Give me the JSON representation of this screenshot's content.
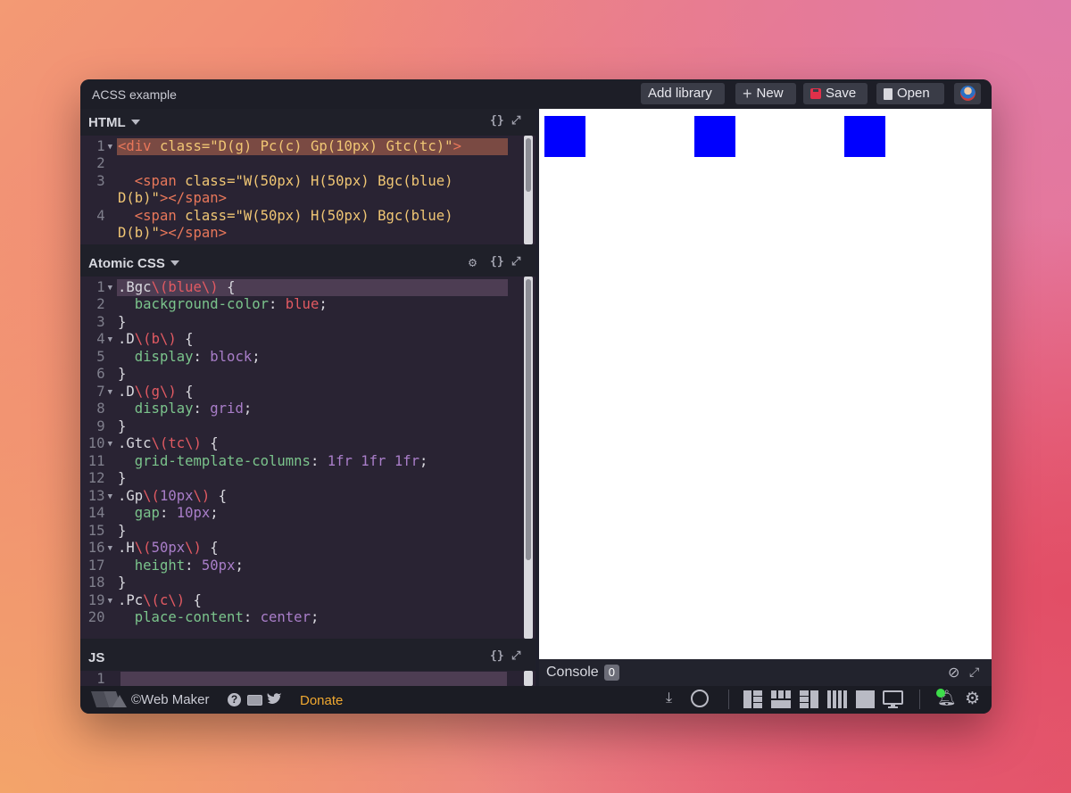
{
  "app": {
    "title": "ACSS example",
    "buttons": {
      "add_library": "Add library",
      "new": "New",
      "save": "Save",
      "open": "Open"
    }
  },
  "html_pane": {
    "label": "HTML",
    "lines": [
      {
        "n": "1",
        "t": "<div class=\"D(g) Pc(c) Gp(10px) Gtc(tc)\">"
      },
      {
        "n": "2",
        "t": ""
      },
      {
        "n": "3",
        "t": "  <span class=\"W(50px) H(50px) Bgc(blue)"
      },
      {
        "n": "",
        "t": "D(b)\"></span>"
      },
      {
        "n": "4",
        "t": "  <span class=\"W(50px) H(50px) Bgc(blue)"
      },
      {
        "n": "",
        "t": "D(b)\"></span>"
      }
    ]
  },
  "css_pane": {
    "label": "Atomic CSS",
    "lines": [
      {
        "n": "1",
        "t": ".Bgc\\(blue\\) {"
      },
      {
        "n": "2",
        "t": "  background-color: blue;"
      },
      {
        "n": "3",
        "t": "}"
      },
      {
        "n": "4",
        "t": ".D\\(b\\) {"
      },
      {
        "n": "5",
        "t": "  display: block;"
      },
      {
        "n": "6",
        "t": "}"
      },
      {
        "n": "7",
        "t": ".D\\(g\\) {"
      },
      {
        "n": "8",
        "t": "  display: grid;"
      },
      {
        "n": "9",
        "t": "}"
      },
      {
        "n": "10",
        "t": ".Gtc\\(tc\\) {"
      },
      {
        "n": "11",
        "t": "  grid-template-columns: 1fr 1fr 1fr;"
      },
      {
        "n": "12",
        "t": "}"
      },
      {
        "n": "13",
        "t": ".Gp\\(10px\\) {"
      },
      {
        "n": "14",
        "t": "  gap: 10px;"
      },
      {
        "n": "15",
        "t": "}"
      },
      {
        "n": "16",
        "t": ".H\\(50px\\) {"
      },
      {
        "n": "17",
        "t": "  height: 50px;"
      },
      {
        "n": "18",
        "t": "}"
      },
      {
        "n": "19",
        "t": ".Pc\\(c\\) {"
      },
      {
        "n": "20",
        "t": "  place-content: center;"
      }
    ]
  },
  "js_pane": {
    "label": "JS",
    "lines": [
      {
        "n": "1",
        "t": ""
      }
    ]
  },
  "preview": {
    "box_color": "#0000ff",
    "box_count": 3
  },
  "console": {
    "label": "Console",
    "count": "0"
  },
  "footer": {
    "brand": "©Web Maker",
    "donate": "Donate"
  },
  "colors": {
    "accent_donate": "#f0a830",
    "save_icon": "#e0304a",
    "notification_dot": "#3ddc4a"
  }
}
